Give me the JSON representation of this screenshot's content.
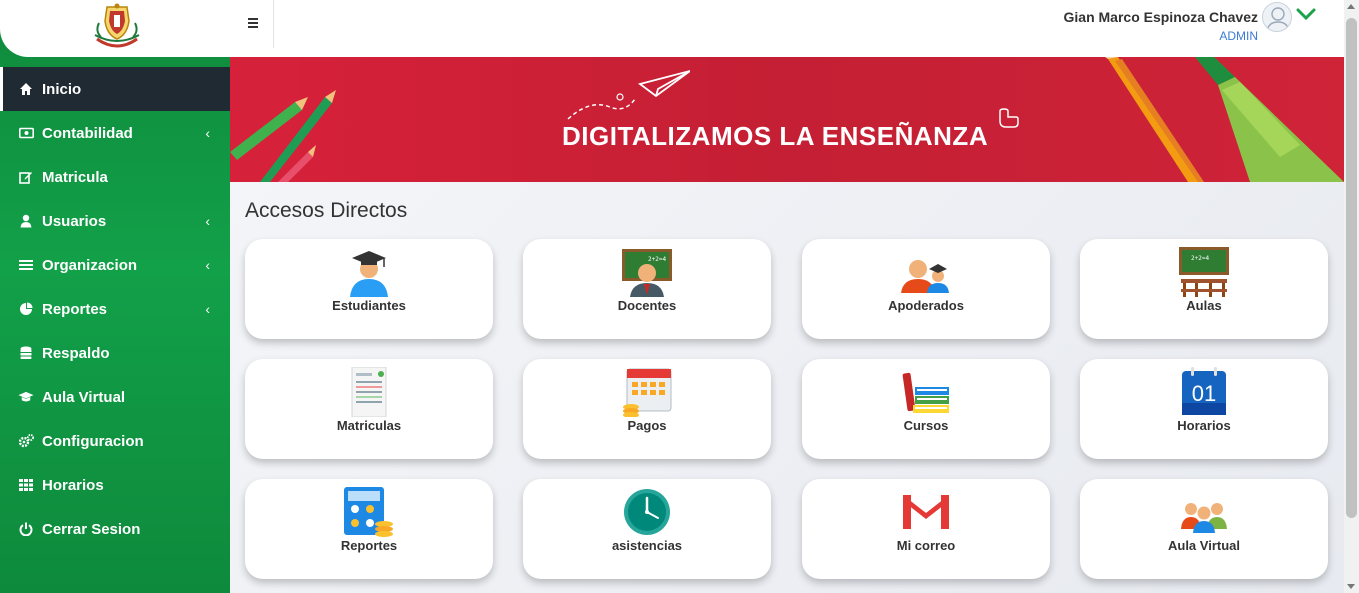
{
  "header": {
    "user_name": "Gian Marco Espinoza Chavez",
    "user_role": "ADMIN"
  },
  "sidebar": {
    "items": [
      {
        "label": "Inicio",
        "icon": "home-icon",
        "active": true,
        "has_submenu": false
      },
      {
        "label": "Contabilidad",
        "icon": "money-icon",
        "has_submenu": true
      },
      {
        "label": "Matricula",
        "icon": "edit-icon",
        "has_submenu": false
      },
      {
        "label": "Usuarios",
        "icon": "user-icon",
        "has_submenu": true
      },
      {
        "label": "Organizacion",
        "icon": "bars-icon",
        "has_submenu": true
      },
      {
        "label": "Reportes",
        "icon": "pie-chart-icon",
        "has_submenu": true
      },
      {
        "label": "Respaldo",
        "icon": "database-icon",
        "has_submenu": false
      },
      {
        "label": "Aula Virtual",
        "icon": "graduation-cap-icon",
        "has_submenu": false
      },
      {
        "label": "Configuracion",
        "icon": "cogs-icon",
        "has_submenu": false
      },
      {
        "label": "Horarios",
        "icon": "grid-icon",
        "has_submenu": false
      },
      {
        "label": "Cerrar Sesion",
        "icon": "power-icon",
        "has_submenu": false
      }
    ],
    "chevron": "‹"
  },
  "banner": {
    "title": "DIGITALIZAMOS LA ENSEÑANZA"
  },
  "main": {
    "section_title": "Accesos Directos",
    "shortcuts": [
      {
        "label": "Estudiantes",
        "icon": "student-icon"
      },
      {
        "label": "Docentes",
        "icon": "teacher-icon"
      },
      {
        "label": "Apoderados",
        "icon": "parents-icon"
      },
      {
        "label": "Aulas",
        "icon": "classroom-icon"
      },
      {
        "label": "Matriculas",
        "icon": "enrollment-form-icon"
      },
      {
        "label": "Pagos",
        "icon": "payments-calendar-icon"
      },
      {
        "label": "Cursos",
        "icon": "books-icon"
      },
      {
        "label": "Horarios",
        "icon": "calendar-icon"
      },
      {
        "label": "Reportes",
        "icon": "calculator-icon"
      },
      {
        "label": "asistencias",
        "icon": "clock-icon"
      },
      {
        "label": "Mi correo",
        "icon": "gmail-icon"
      },
      {
        "label": "Aula Virtual",
        "icon": "group-icon"
      }
    ]
  },
  "colors": {
    "sidebar_green": "#12a049",
    "active_item": "#1f2a33",
    "banner_red": "#d7213a",
    "role_blue": "#3a7bd5"
  }
}
